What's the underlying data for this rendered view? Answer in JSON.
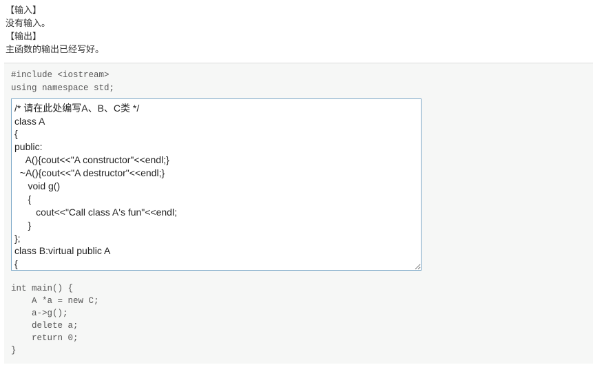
{
  "description": {
    "input_header": "【输入】",
    "input_body": "没有输入。",
    "output_header": "【输出】",
    "output_body": "主函数的输出已经写好。"
  },
  "code_before": "#include <iostream>\nusing namespace std;",
  "editor_value": "/* 请在此处编写A、B、C类 */\nclass A\n{\npublic:\n    A(){cout<<\"A constructor\"<<endl;}\n  ~A(){cout<<\"A destructor\"<<endl;}\n     void g()\n     {\n        cout<<\"Call class A's fun\"<<endl;\n     }\n};\nclass B:virtual public A\n{\npublic:",
  "code_after": "int main() {\n    A *a = new C;\n    a->g();\n    delete a;\n    return 0;\n}"
}
